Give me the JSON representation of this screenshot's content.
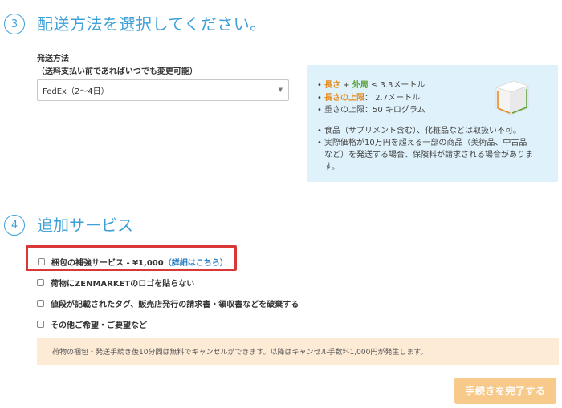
{
  "step3": {
    "number": "3",
    "title": "配送方法を選択してください。",
    "shipping_label": "発送方法",
    "shipping_sublabel": "（送料支払い前であればいつでも変更可能）",
    "select_value": "FedEx（2〜4日）",
    "select_caret": "▼",
    "info": {
      "limits": [
        {
          "part1": "長さ",
          "plus": " + ",
          "part2": "外周",
          "rest": " ≤ 3.3メートル"
        },
        {
          "part1": "長さの上限",
          "rest": "：  2.7メートル"
        },
        {
          "rest": "重さの上限：50 キログラム"
        }
      ],
      "notes": [
        "食品（サプリメント含む）、化粧品などは取扱い不可。",
        "実際価格が10万円を超える一部の商品（美術品、中古品など）を発送する場合、保険料が請求される場合があります。"
      ]
    }
  },
  "step4": {
    "number": "4",
    "title": "追加サービス",
    "services": [
      {
        "label": "梱包の補強サービス - ¥1,000",
        "link_open": "（",
        "link": "詳細はこちら",
        "link_close": "）",
        "checked": false
      },
      {
        "label": "荷物にZENMARKETのロゴを貼らない",
        "checked": false
      },
      {
        "label": "値段が記載されたタグ、販売店発行の請求書・領収書などを破棄する",
        "checked": false
      },
      {
        "label": "その他ご希望・ご要望など",
        "checked": false
      }
    ]
  },
  "notice": "荷物の梱包・発送手続き後10分間は無料でキャンセルができます。以降はキャンセル手数料1,000円が発生します。",
  "complete_button": "手続きを完了する",
  "colors": {
    "accent": "#3ea0d8",
    "info_bg": "#dff2fb",
    "notice_bg": "#fdebd6",
    "button_bg": "#f7c98b",
    "highlight": "#d93838",
    "orange": "#e58a1f",
    "green": "#5aa33b"
  }
}
